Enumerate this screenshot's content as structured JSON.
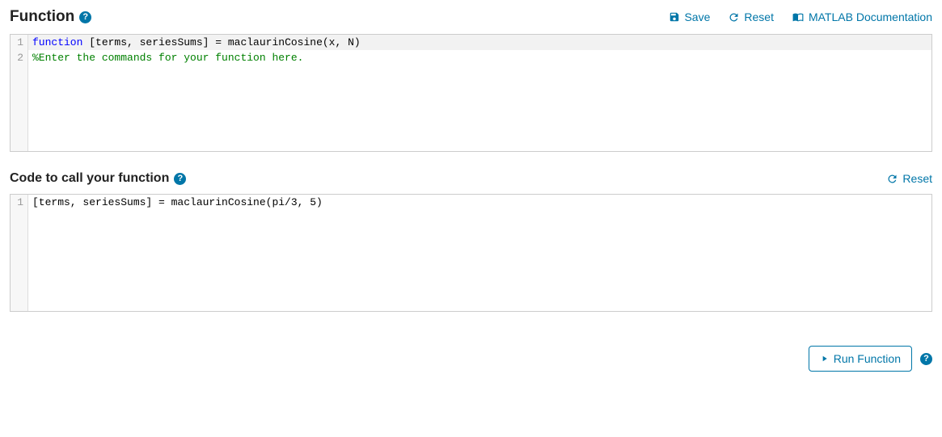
{
  "section1": {
    "title": "Function",
    "toolbar": {
      "save": "Save",
      "reset": "Reset",
      "docs": "MATLAB Documentation"
    },
    "code": {
      "line1_kw": "function",
      "line1_rest": " [terms, seriesSums] = maclaurinCosine(x, N)",
      "line2": "%Enter the commands for your function here."
    }
  },
  "section2": {
    "title": "Code to call your function",
    "toolbar": {
      "reset": "Reset"
    },
    "code": {
      "line1": "[terms, seriesSums] = maclaurinCosine(pi/3, 5)"
    }
  },
  "footer": {
    "run": "Run Function"
  }
}
